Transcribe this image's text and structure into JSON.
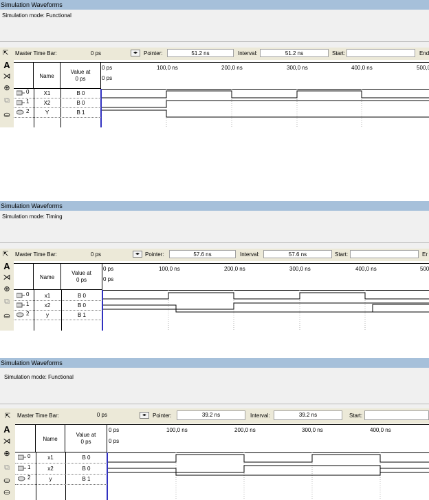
{
  "panels": [
    {
      "title": "Simulation Waveforms",
      "mode_text": "Simulation mode: Functional",
      "timebar": {
        "master_label": "Master Time Bar:",
        "master_value": "0 ps",
        "pointer_label": "Pointer:",
        "pointer_value": "51.2 ns",
        "interval_label": "Interval:",
        "interval_value": "51.2 ns",
        "start_label": "Start:",
        "start_value": "",
        "end_label": "End"
      },
      "header": {
        "name": "Name",
        "value_at": "Value at",
        "value_time": "0 ps"
      },
      "time_labels": [
        "0 ps",
        "100,0 ns",
        "200,0 ns",
        "300,0 ns",
        "400,0 ns",
        "500,0"
      ],
      "cursor_label": "0 ps",
      "signals": [
        {
          "index": "0",
          "name": "X1",
          "value": "B 0",
          "type": "input",
          "edges": [
            0,
            1,
            0,
            1,
            0
          ]
        },
        {
          "index": "1",
          "name": "X2",
          "value": "B 0",
          "type": "input",
          "edges": [
            0,
            1,
            1,
            1,
            1
          ]
        },
        {
          "index": "2",
          "name": "Y",
          "value": "B 1",
          "type": "output",
          "edges": [
            1,
            0,
            0,
            0,
            0
          ]
        }
      ]
    },
    {
      "title": "Simulation Waveforms",
      "mode_text": "Simulation mode: Timing",
      "timebar": {
        "master_label": "Master Time Bar:",
        "master_value": "0 ps",
        "pointer_label": "Pointer:",
        "pointer_value": "57.6 ns",
        "interval_label": "Interval:",
        "interval_value": "57.6 ns",
        "start_label": "Start:",
        "start_value": "",
        "end_label": "Er"
      },
      "header": {
        "name": "Name",
        "value_at": "Value at",
        "value_time": "0 ps"
      },
      "time_labels": [
        "0 ps",
        "100,0 ns",
        "200,0 ns",
        "300,0 ns",
        "400,0 ns",
        "500"
      ],
      "cursor_label": "0 ps",
      "signals": [
        {
          "index": "0",
          "name": "x1",
          "value": "B 0",
          "type": "input"
        },
        {
          "index": "1",
          "name": "x2",
          "value": "B 0",
          "type": "input"
        },
        {
          "index": "2",
          "name": "y",
          "value": "B 1",
          "type": "output"
        }
      ]
    },
    {
      "title": "Simulation Waveforms",
      "mode_text": "Simulation mode: Functional",
      "timebar": {
        "master_label": "Master Time Bar:",
        "master_value": "0 ps",
        "pointer_label": "Pointer:",
        "pointer_value": "39.2 ns",
        "interval_label": "Interval:",
        "interval_value": "39.2 ns",
        "start_label": "Start:",
        "start_value": "",
        "end_label": ""
      },
      "header": {
        "name": "Name",
        "value_at": "Value at",
        "value_time": "0 ps"
      },
      "time_labels": [
        "0 ps",
        "100,0 ns",
        "200,0 ns",
        "300,0 ns",
        "400,0 ns"
      ],
      "cursor_label": "0 ps",
      "signals": [
        {
          "index": "0",
          "name": "x1",
          "value": "B 0",
          "type": "input"
        },
        {
          "index": "1",
          "name": "x2",
          "value": "B 0",
          "type": "input"
        },
        {
          "index": "2",
          "name": "y",
          "value": "B 1",
          "type": "output"
        }
      ]
    }
  ],
  "tool_icons": [
    "selection-tool-icon",
    "text-tool-icon",
    "waveform-editing-tool-icon",
    "zoom-tool-icon",
    "full-screen-icon",
    "find-icon"
  ]
}
